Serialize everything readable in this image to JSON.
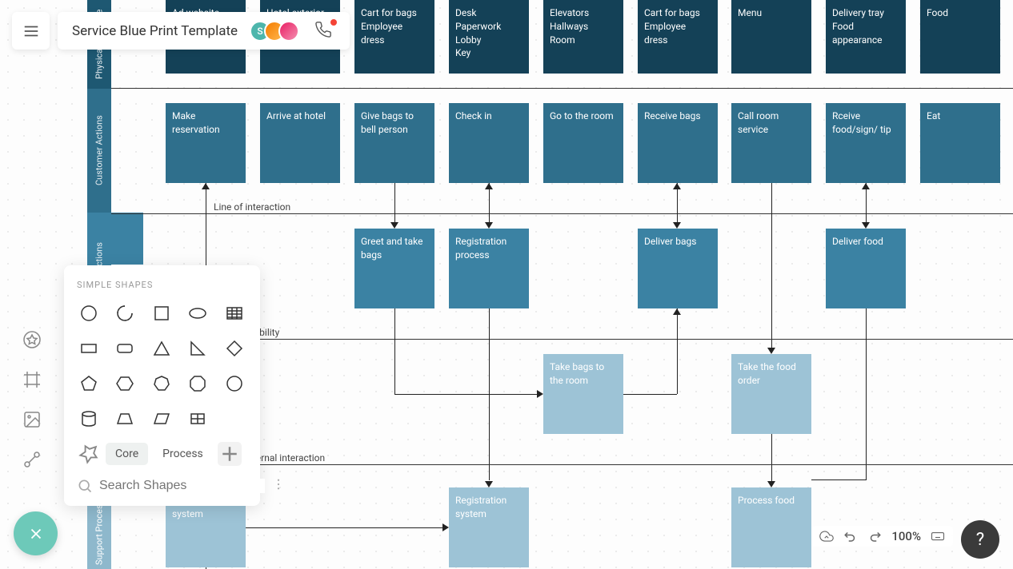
{
  "title": "Service Blue Print Template",
  "avatar_initial": "S",
  "lanes": {
    "l1": "Physical Evidence",
    "l2": "Customer Actions",
    "l3": "Onstage Actions",
    "l4": "Support Processes"
  },
  "row1": [
    {
      "lines": [
        "Ad website"
      ]
    },
    {
      "lines": [
        "Hotel exterior"
      ]
    },
    {
      "lines": [
        "Cart for bags",
        "Employee dress"
      ]
    },
    {
      "lines": [
        "Desk",
        "Paperwork",
        "Lobby",
        "Key"
      ]
    },
    {
      "lines": [
        "Elevators",
        "Hallways",
        "Room"
      ]
    },
    {
      "lines": [
        "Cart for bags",
        "Employee dress"
      ]
    },
    {
      "lines": [
        "Menu"
      ]
    },
    {
      "lines": [
        "Delivery tray",
        "Food appearance"
      ]
    },
    {
      "lines": [
        "Food"
      ]
    }
  ],
  "row2": [
    "Make reservation",
    "Arrive at hotel",
    "Give bags to bell person",
    "Check in",
    "Go to the room",
    "Receive bags",
    "Call room service",
    "Rceive food/sign/ tip",
    "Eat"
  ],
  "row3": {
    "greet": "Greet and take bags",
    "reg": "Registration process",
    "deliver_bags": "Deliver bags",
    "deliver_food": "Deliver food"
  },
  "row4": {
    "take_bags": "Take bags to the room",
    "take_order": "Take the food order"
  },
  "row5": {
    "reservation": "Reservation system",
    "registration": "Registration system",
    "process_food": "Process food"
  },
  "dividers": {
    "interaction": "Line of interaction",
    "visibility": "Line of visibility",
    "internal": "Line of internal interaction"
  },
  "shapes": {
    "title": "SIMPLE SHAPES",
    "tab_core": "Core",
    "tab_process": "Process",
    "search_placeholder": "Search Shapes"
  },
  "zoom": "100%"
}
